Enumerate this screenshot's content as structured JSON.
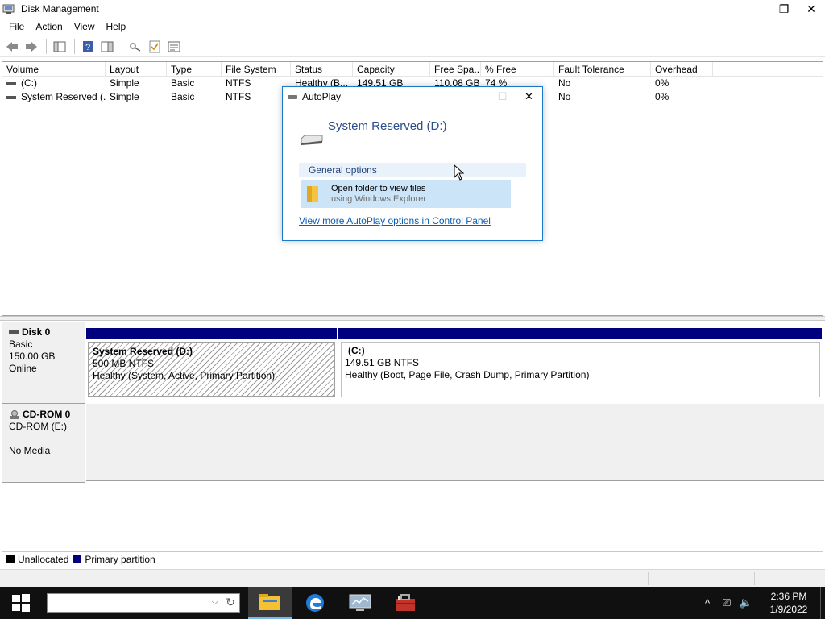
{
  "window": {
    "title": "Disk Management",
    "minimize": "—",
    "restore": "❐",
    "close": "✕"
  },
  "menu": [
    "File",
    "Action",
    "View",
    "Help"
  ],
  "volume_list": {
    "columns": [
      "Volume",
      "Layout",
      "Type",
      "File System",
      "Status",
      "Capacity",
      "Free Spa...",
      "% Free",
      "Fault Tolerance",
      "Overhead"
    ],
    "rows": [
      [
        "(C:)",
        "Simple",
        "Basic",
        "NTFS",
        "Healthy (B...",
        "149.51 GB",
        "110.08 GB",
        "74 %",
        "No",
        "0%"
      ],
      [
        "System Reserved (...",
        "Simple",
        "Basic",
        "NTFS",
        "",
        "",
        "",
        "",
        "No",
        "0%"
      ]
    ]
  },
  "disks": [
    {
      "name": "Disk 0",
      "type": "Basic",
      "size": "150.00 GB",
      "state": "Online",
      "partitions": [
        {
          "name": "System Reserved  (D:)",
          "size": "500 MB NTFS",
          "status": "Healthy (System, Active, Primary Partition)"
        },
        {
          "name": "(C:)",
          "size": "149.51 GB NTFS",
          "status": "Healthy (Boot, Page File, Crash Dump, Primary Partition)"
        }
      ]
    },
    {
      "name": "CD-ROM 0",
      "type": "CD-ROM (E:)",
      "media": "No Media"
    }
  ],
  "legend": [
    {
      "label": "Unallocated",
      "color": "#000000"
    },
    {
      "label": "Primary partition",
      "color": "#00007f"
    }
  ],
  "autoplay": {
    "title": "AutoPlay",
    "heading": "System Reserved (D:)",
    "group": "General options",
    "option_title": "Open folder to view files",
    "option_sub": "using Windows Explorer",
    "link": "View more AutoPlay options in Control Panel",
    "minimize": "—",
    "maximize": "☐",
    "close": "✕"
  },
  "taskbar": {
    "search_chevron": "⌵",
    "search_refresh": "↻",
    "time": "2:36 PM",
    "date": "1/9/2022",
    "tray": {
      "chevron": "^",
      "network": "⎚",
      "volume": "🔈"
    }
  },
  "colors": {
    "primary_partition": "#00007f",
    "accent": "#1979ca",
    "link": "#0a5fb4"
  }
}
